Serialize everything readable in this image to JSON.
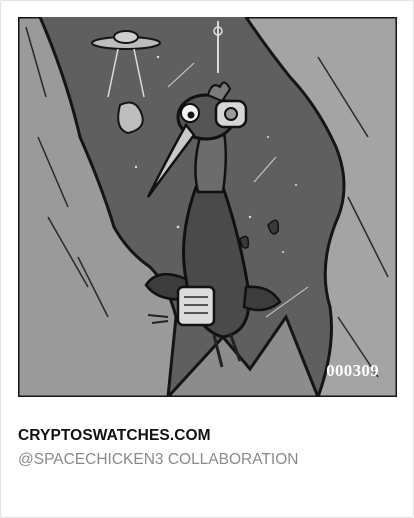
{
  "card": {
    "edition_number": "000309",
    "title": "CRYPTOSWATCHES.COM",
    "subtitle": "@SPACECHICKEN3 COLLABORATION"
  },
  "artwork": {
    "subject": "space-chicken-illustration-icon",
    "style": "grayscale"
  }
}
